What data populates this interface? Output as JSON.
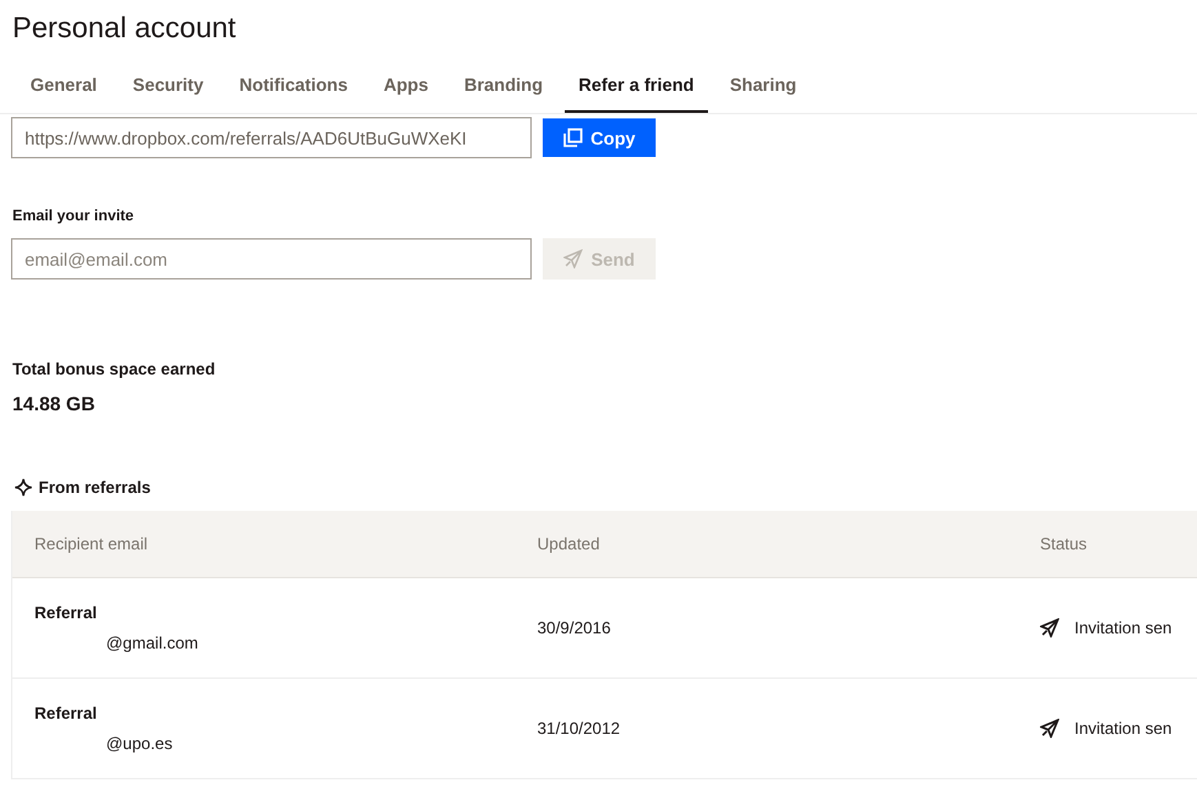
{
  "title": "Personal account",
  "tabs": [
    {
      "label": "General",
      "selected": false
    },
    {
      "label": "Security",
      "selected": false
    },
    {
      "label": "Notifications",
      "selected": false
    },
    {
      "label": "Apps",
      "selected": false
    },
    {
      "label": "Branding",
      "selected": false
    },
    {
      "label": "Refer a friend",
      "selected": true
    },
    {
      "label": "Sharing",
      "selected": false
    }
  ],
  "link": {
    "value": "https://www.dropbox.com/referrals/AAD6UtBuGuWXeKI",
    "button": "Copy"
  },
  "invite": {
    "label": "Email your invite",
    "placeholder": "email@email.com",
    "button": "Send",
    "disabled": true
  },
  "bonus": {
    "label": "Total bonus space earned",
    "value": "14.88 GB"
  },
  "referrals": {
    "heading": "From referrals",
    "columns": [
      "Recipient email",
      "Updated",
      "Status"
    ],
    "rows": [
      {
        "title": "Referral",
        "email": "@gmail.com",
        "updated": "30/9/2016",
        "status": "Invitation sen"
      },
      {
        "title": "Referral",
        "email": "@upo.es",
        "updated": "31/10/2012",
        "status": "Invitation sen"
      }
    ]
  }
}
